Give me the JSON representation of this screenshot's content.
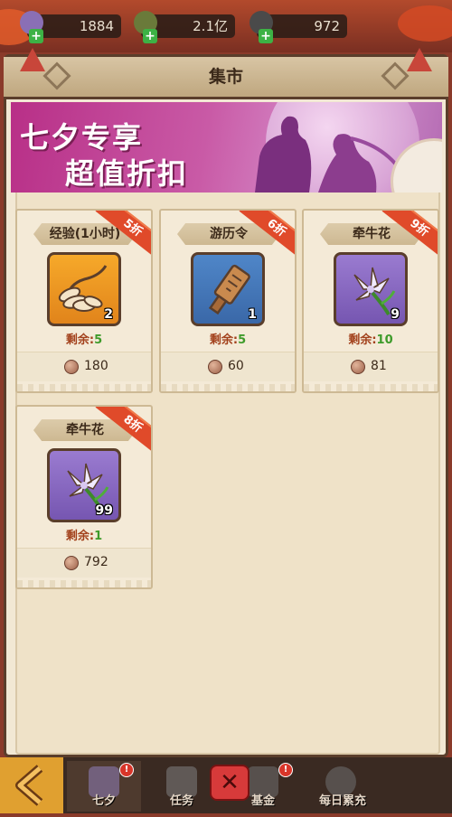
{
  "resources": [
    {
      "value": "1884",
      "icon": "flower-icon"
    },
    {
      "value": "2.1亿",
      "icon": "feather-icon"
    },
    {
      "value": "972",
      "icon": "coin-icon"
    }
  ],
  "panel": {
    "title": "集市"
  },
  "banner": {
    "line1": "七夕专享",
    "line2": "超值折扣"
  },
  "items": [
    {
      "name": "经验(1小时)",
      "discount": "5折",
      "qty": "2",
      "remain_label": "剩余:",
      "remain": "5",
      "price": "180",
      "color": "orange",
      "icon": "bananas-icon"
    },
    {
      "name": "游历令",
      "discount": "6折",
      "qty": "1",
      "remain_label": "剩余:",
      "remain": "5",
      "price": "60",
      "color": "blue",
      "icon": "token-icon"
    },
    {
      "name": "牵牛花",
      "discount": "9折",
      "qty": "9",
      "remain_label": "剩余:",
      "remain": "10",
      "price": "81",
      "color": "purple",
      "icon": "morning-glory-icon"
    },
    {
      "name": "牵牛花",
      "discount": "8折",
      "qty": "99",
      "remain_label": "剩余:",
      "remain": "1",
      "price": "792",
      "color": "purple",
      "icon": "morning-glory-icon"
    }
  ],
  "nav": {
    "tabs": [
      {
        "label": "七夕",
        "badge": "!"
      },
      {
        "label": "任务",
        "badge": ""
      },
      {
        "label": "基金",
        "badge": "!"
      },
      {
        "label": "每日累充",
        "badge": ""
      }
    ]
  }
}
